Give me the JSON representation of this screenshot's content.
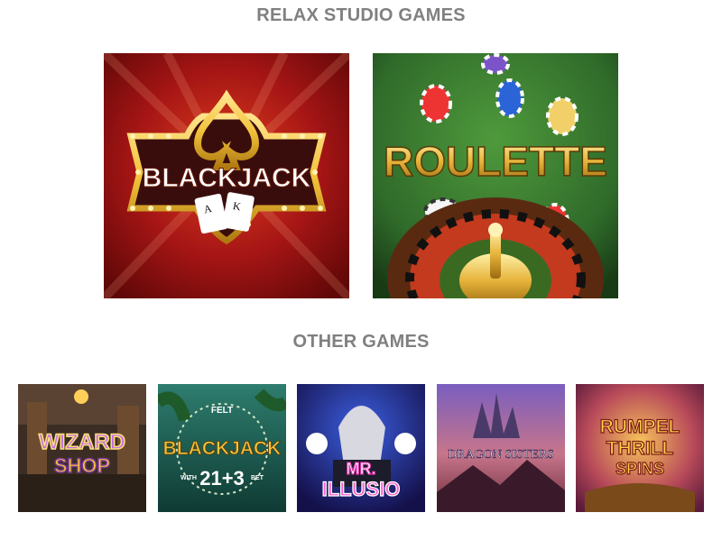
{
  "sections": {
    "relax_title": "RELAX STUDIO GAMES",
    "other_title": "OTHER GAMES"
  },
  "relax_games": [
    {
      "name": "BLACKJACK",
      "icon": "spade-icon"
    },
    {
      "name": "ROULETTE",
      "icon": "roulette-wheel-icon"
    }
  ],
  "other_games": [
    {
      "line1": "WIZARD",
      "line2": "SHOP"
    },
    {
      "top": "FELT",
      "line1": "BLACKJACK",
      "number": "21+3",
      "left": "WITH",
      "right": "BET"
    },
    {
      "line1": "MR.",
      "line2": "ILLUSIO"
    },
    {
      "line1": "DRAGON SISTERS"
    },
    {
      "line1": "RUMPEL",
      "line2": "THRILL",
      "line3": "SPINS"
    }
  ],
  "colors": {
    "title": "#808080",
    "blackjack_bg": "#a51515",
    "roulette_bg": "#2f6a2a",
    "gold": "#f2c23a"
  }
}
